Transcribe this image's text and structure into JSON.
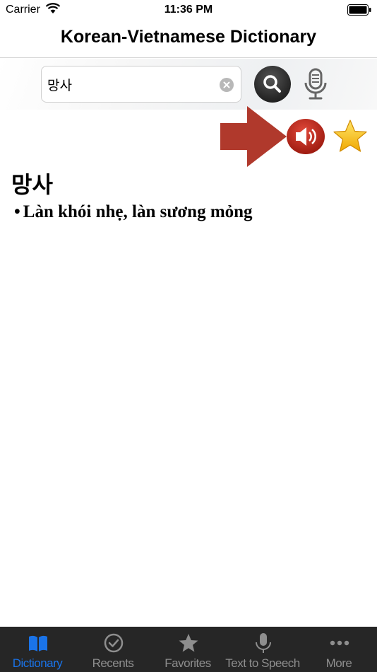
{
  "status_bar": {
    "carrier": "Carrier",
    "time": "11:36 PM"
  },
  "nav": {
    "title": "Korean-Vietnamese Dictionary"
  },
  "search": {
    "value": "망사",
    "placeholder": ""
  },
  "entry": {
    "headword": "망사",
    "bullet": "•",
    "definition": "Làn khói nhẹ, làn sương mỏng"
  },
  "tab_bar": {
    "items": [
      {
        "label": "Dictionary",
        "icon": "book-icon",
        "active": true
      },
      {
        "label": "Recents",
        "icon": "clock-check-icon",
        "active": false
      },
      {
        "label": "Favorites",
        "icon": "star-icon",
        "active": false
      },
      {
        "label": "Text to Speech",
        "icon": "microphone-icon",
        "active": false
      },
      {
        "label": "More",
        "icon": "more-dots-icon",
        "active": false
      }
    ]
  },
  "colors": {
    "accent": "#1a73e8",
    "tab_bar_bg": "#262626",
    "speaker_red": "#c62a1c",
    "arrow_red": "#b0392c",
    "star_gold": "#f5c518"
  }
}
